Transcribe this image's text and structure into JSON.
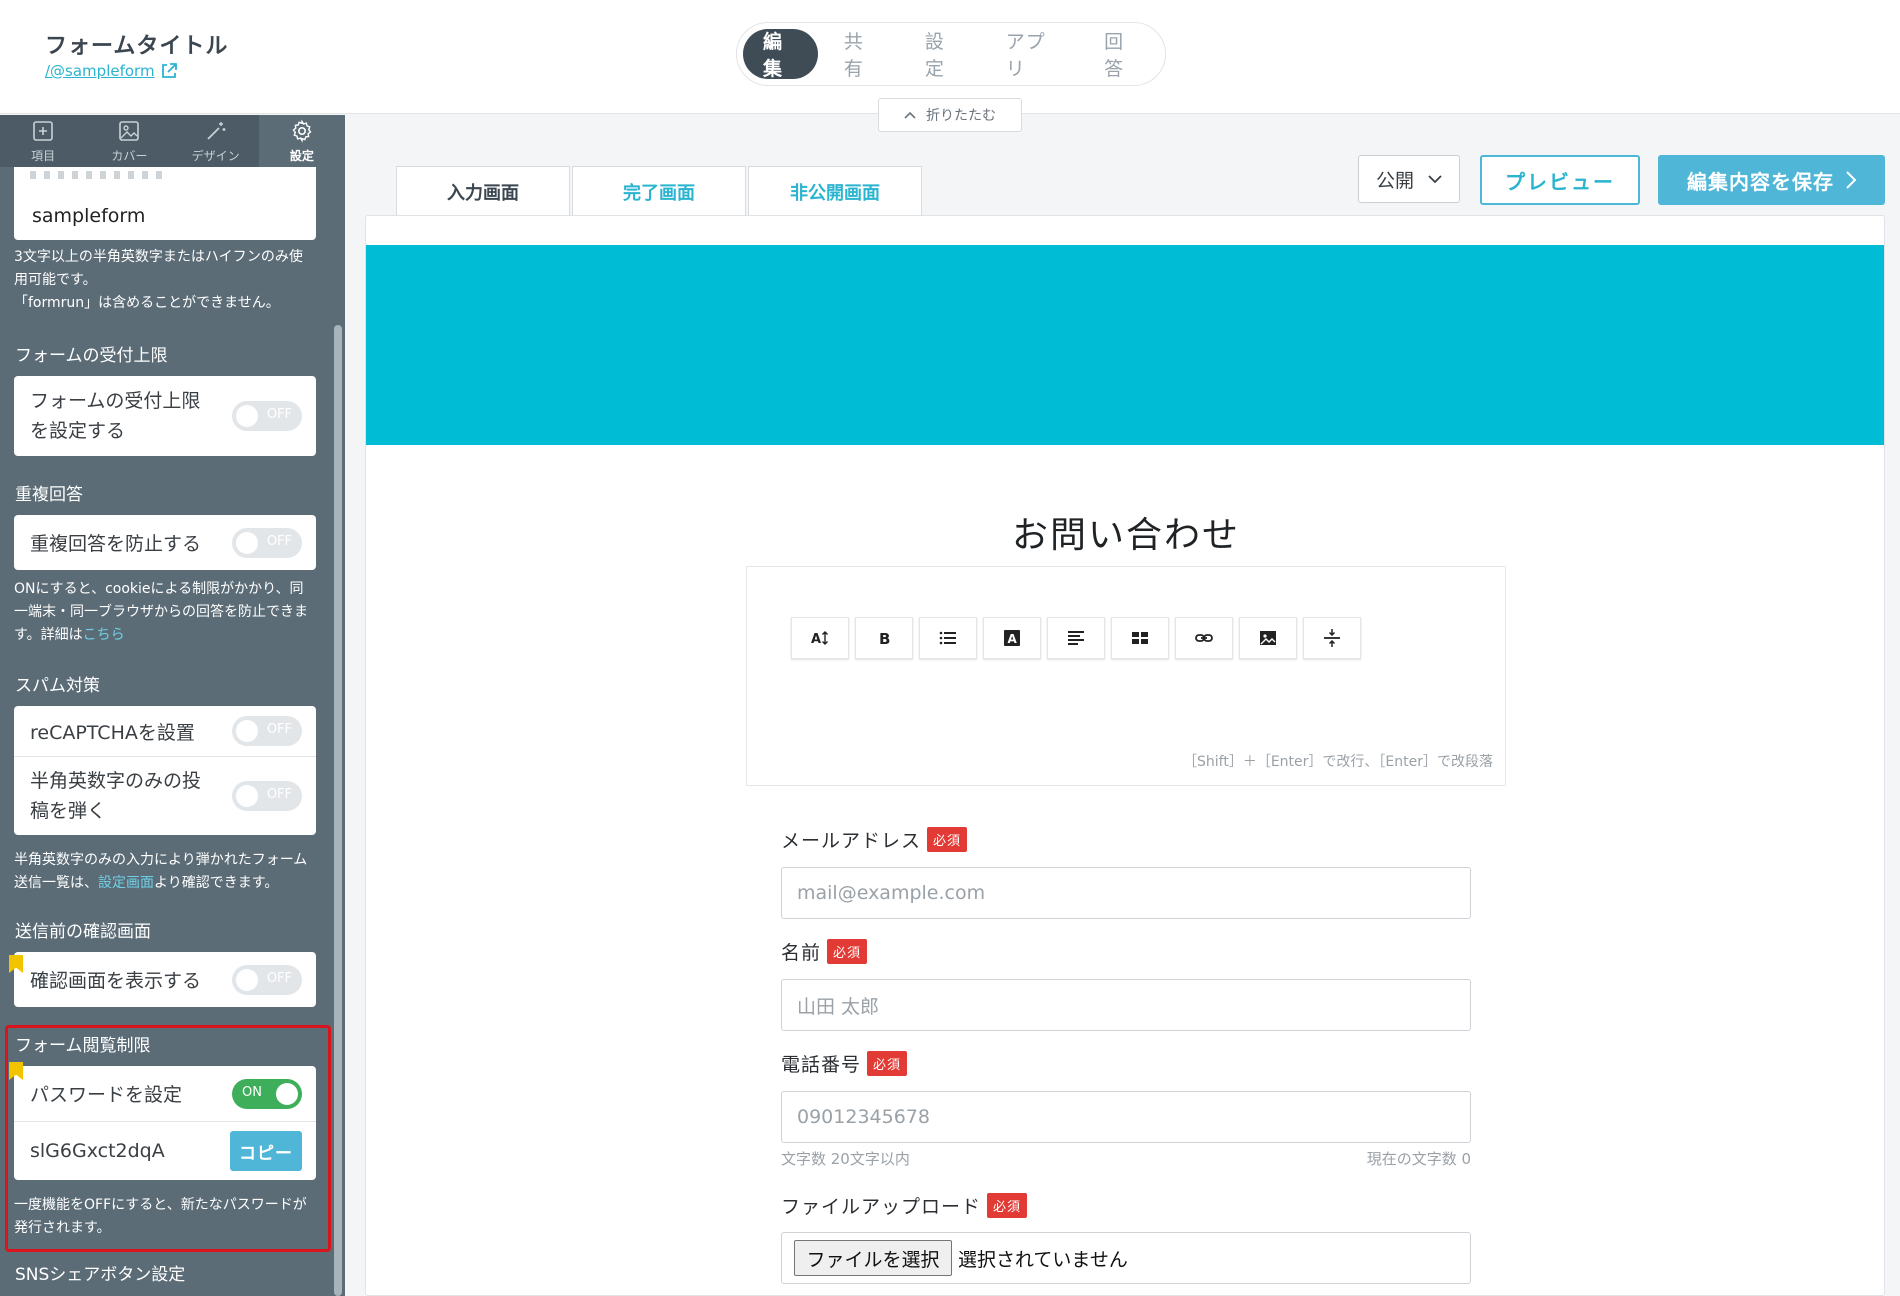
{
  "header": {
    "form_title": "フォームタイトル",
    "form_url": "/@sampleform",
    "nav_tabs": [
      "編集",
      "共有",
      "設定",
      "アプリ",
      "回答"
    ],
    "collapse_label": "折りたたむ"
  },
  "sidebar": {
    "tabs": [
      {
        "label": "項目",
        "icon": "plus-square-icon"
      },
      {
        "label": "カバー",
        "icon": "image-icon"
      },
      {
        "label": "デザイン",
        "icon": "magic-wand-icon"
      },
      {
        "label": "設定",
        "icon": "gear-icon",
        "active": true
      }
    ],
    "slug": {
      "value": "sampleform",
      "note_line1": "3文字以上の半角英数字またはハイフンのみ使用可能です。",
      "note_line2": "「formrun」は含めることができません。"
    },
    "limit": {
      "title": "フォームの受付上限",
      "line1": "フォームの受付上限",
      "line2": "を設定する",
      "toggle": "OFF"
    },
    "duplicate": {
      "title": "重複回答",
      "label": "重複回答を防止する",
      "toggle": "OFF",
      "note": "ONにすると、cookieによる制限がかかり、同一端末・同一ブラウザからの回答を防止できます。詳細は",
      "note_link": "こちら"
    },
    "spam": {
      "title": "スパム対策",
      "recaptcha_label": "reCAPTCHAを設置",
      "recaptcha_toggle": "OFF",
      "alnum_line1": "半角英数字のみの投",
      "alnum_line2": "稿を弾く",
      "alnum_toggle": "OFF",
      "note": "半角英数字のみの入力により弾かれたフォーム送信一覧は、",
      "note_link": "設定画面",
      "note_tail": "より確認できます。"
    },
    "confirm": {
      "title": "送信前の確認画面",
      "label": "確認画面を表示する",
      "toggle": "OFF"
    },
    "password": {
      "title": "フォーム閲覧制限",
      "label": "パスワードを設定",
      "toggle": "ON",
      "value": "slG6Gxct2dqA",
      "copy_label": "コピー",
      "note": "一度機能をOFFにすると、新たなパスワードが発行されます。"
    },
    "sns_title": "SNSシェアボタン設定"
  },
  "editor": {
    "page_tabs": [
      "入力画面",
      "完了画面",
      "非公開画面"
    ],
    "publish_select": "公開",
    "preview_label": "プレビュー",
    "save_label": "編集内容を保存",
    "cover_color": "#00bcd4",
    "form_heading": "お問い合わせ",
    "toolbar_hint": "［Shift］＋［Enter］で改行、［Enter］で改段落",
    "required_badge": "必須",
    "fields": {
      "email_label": "メールアドレス",
      "email_placeholder": "mail@example.com",
      "name_label": "名前",
      "name_placeholder": "山田 太郎",
      "phone_label": "電話番号",
      "phone_placeholder": "09012345678",
      "phone_limit": "文字数 20文字以内",
      "phone_count": "現在の文字数 0",
      "file_label": "ファイルアップロード",
      "file_button": "ファイルを選択",
      "file_status": "選択されていません"
    }
  },
  "colors": {
    "accent": "#4fb6d8",
    "sidebar": "#5b6c77",
    "required": "#e23b36",
    "toggle_on": "#3fae5a",
    "highlight_box": "#d9151b"
  }
}
